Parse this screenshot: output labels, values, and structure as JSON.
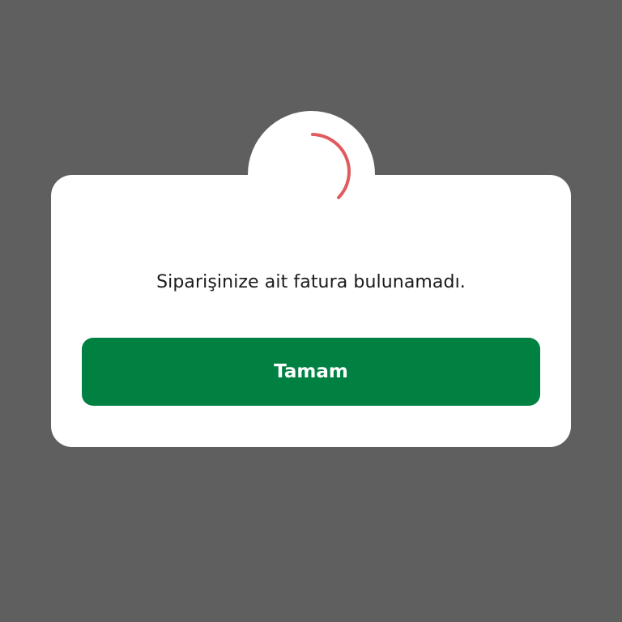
{
  "dialog": {
    "message": "Siparişinize ait fatura bulunamadı.",
    "ok_label": "Tamam"
  },
  "colors": {
    "backdrop": "#5f5f5f",
    "dialog_background": "#ffffff",
    "primary_button": "#008142",
    "button_text": "#ffffff",
    "spinner": "#e05a5f"
  },
  "icons": {
    "status": "loading-spinner-icon"
  }
}
